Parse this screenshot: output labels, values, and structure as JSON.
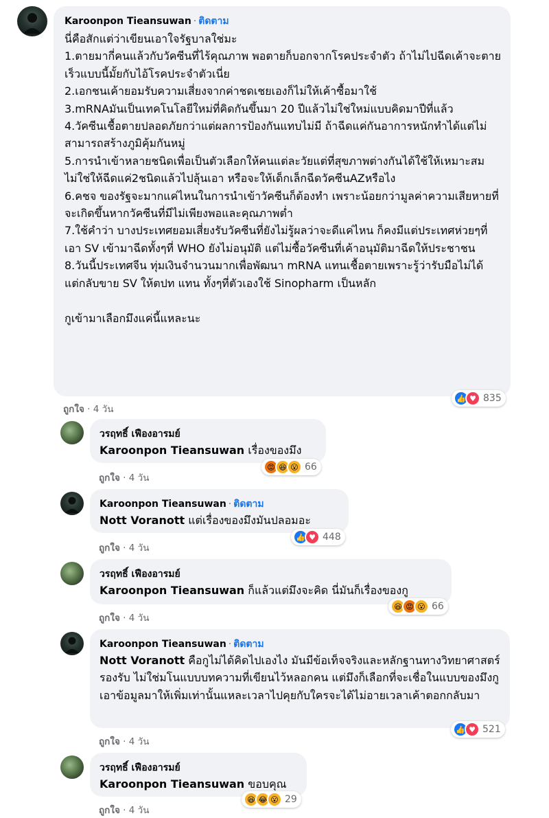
{
  "colors": {
    "bubble": "#f0f2f5",
    "follow": "#1b74e4",
    "meta": "#65676b",
    "like": "#1877f2",
    "love": "#f33e58"
  },
  "comments": [
    {
      "author": "Karoonpon Tieansuwan",
      "separator": "·",
      "follow": "ติดตาม",
      "mention": "",
      "text": "นี่คือสักแต่ว่าเขียนเอาใจรัฐบาลใช่มะ\n1.ตายมากี่คนแล้วกับวัคซีนที่ไร้คุณภาพ พอตายก็บอกจากโรคประจำตัว ถ้าไม่ไปฉีดเค้าจะตายเร็วแบบนี้มั้ยกับไอ้โรคประจำตัวเนี่ย\n2.เอกชนเค้ายอมรับความเสี่ยงจากค่าชดเชยเองก็ไม่ให้เค้าซื้อมาใช้\n3.mRNAมันเป็นเทคโนโลยีใหม่ที่คิดกันขึ้นมา 20 ปีแล้วไม่ใช่ใหม่แบบคิดมาปีที่แล้ว\n4.วัคซีนเชื้อตายปลอดภัยกว่าแต่ผลการป้องกันแทบไม่มี ถ้าฉีดแค่กันอาการหนักทำได้แต่ไม่สามารถสร้างภูมิคุ้มกันหมู่\n5.การนำเข้าหลายชนิดเพื่อเป็นตัวเลือกให้คนแต่ละวัยแต่ที่สุขภาพต่างกันได้ใช้ให้เหมาะสมไม่ใช่ให้ฉีดแค่2ชนิดแล้วไปลุ้นเอา หรือจะให้เด็กเล็กฉีดวัคซีนAZหรือไง\n6.คชจ ของรัฐจะมากแค่ไหนในการนำเข้าวัคซีนก็ต้องทำ เพราะน้อยกว่ามูลค่าความเสียหายที่จะเกิดขึ้นหากวัคซีนที่มีไม่เพียงพอและคุณภาพต่ำ\n7.ใช้คำว่า บางประเทศยอมเสี่ยงรับวัคซีนที่ยังไม่รู้ผลว่าจะดีแค่ไหน ก็คงมีแต่ประเทศห่วยๆที่เอา SV เข้ามาฉีดทั้งๆที่ WHO ยังไม่อนุมัติ แต่ไม่ซื้อวัคซีนที่เค้าอนุมัติมาฉีดให้ประชาชน\n8.วันนี้ประเทศจีน ทุ่มเงินจำนวนมากเพื่อพัฒนา mRNA แทนเชื้อตายเพราะรู้ว่ารับมือไม่ได้ แต่กลับขาย SV ให้ตปท แทน ทั้งๆที่ตัวเองใช้ Sinopharm เป็นหลัก\n\nกูเข้ามาเลือกมึงแค่นี้แหละนะ",
      "like": "ถูกใจ",
      "time": "4 วัน",
      "reaction_count": "835",
      "reactions": [
        "like",
        "love"
      ]
    },
    {
      "author": "วรฤทธิ์ เฟืองอารมย์",
      "separator": "",
      "follow": "",
      "mention": "Karoonpon Tieansuwan",
      "text": " เรื่องของมึง",
      "like": "ถูกใจ",
      "time": "4 วัน",
      "reaction_count": "66",
      "reactions": [
        "angry",
        "haha",
        "wow"
      ]
    },
    {
      "author": "Karoonpon Tieansuwan",
      "separator": "·",
      "follow": "ติดตาม",
      "mention": "Nott Voranott",
      "text": " แต่เรื่องของมึงมันปลอมอะ",
      "like": "ถูกใจ",
      "time": "4 วัน",
      "reaction_count": "448",
      "reactions": [
        "like",
        "love"
      ]
    },
    {
      "author": "วรฤทธิ์ เฟืองอารมย์",
      "separator": "",
      "follow": "",
      "mention": "Karoonpon Tieansuwan",
      "text": " ก็แล้วแต่มึงจะคิด นี่มันก็เรื่องของกู",
      "like": "ถูกใจ",
      "time": "4 วัน",
      "reaction_count": "66",
      "reactions": [
        "haha",
        "angry",
        "wow"
      ]
    },
    {
      "author": "Karoonpon Tieansuwan",
      "separator": "·",
      "follow": "ติดตาม",
      "mention": "Nott Voranott",
      "text": " คือกูไม่ได้คิดไปเองไง มันมีข้อเท็จจริงและหลักฐานทางวิทยาศาสตร์รองรับ ไม่ใช่มโนแบบบทความที่เขียนไว้หลอกคน แต่มึงก็เลือกที่จะเชื่อในแบบของมึงกูเอาข้อมูลมาให้เพิ่มเท่านั้นแหละเวลาไปคุยกับใครจะได้ไม่อายเวลาเค้าตอกกลับมา",
      "like": "ถูกใจ",
      "time": "4 วัน",
      "reaction_count": "521",
      "reactions": [
        "like",
        "love"
      ]
    },
    {
      "author": "วรฤทธิ์ เฟืองอารมย์",
      "separator": "",
      "follow": "",
      "mention": "Karoonpon Tieansuwan",
      "text": " ขอบคุณ",
      "like": "ถูกใจ",
      "time": "4 วัน",
      "reaction_count": "29",
      "reactions": [
        "haha",
        "laugh",
        "wow"
      ]
    }
  ]
}
